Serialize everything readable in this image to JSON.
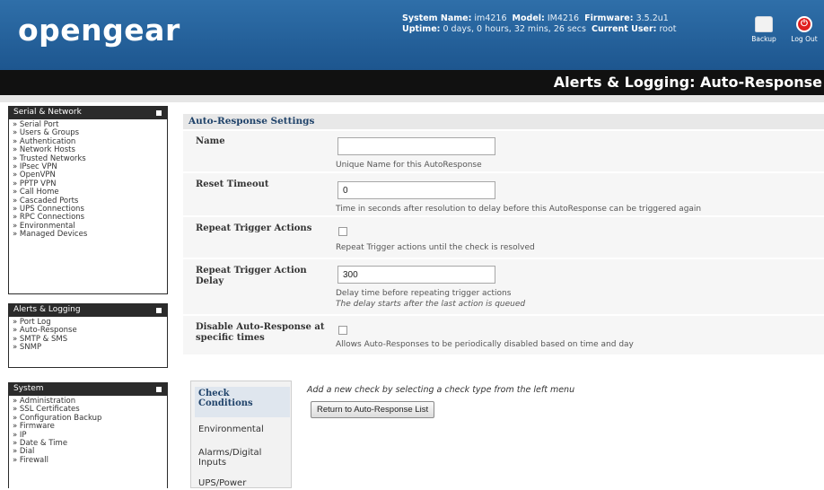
{
  "header": {
    "logo": "opengear",
    "system_name_label": "System Name:",
    "system_name": "im4216",
    "model_label": "Model:",
    "model": "IM4216",
    "firmware_label": "Firmware:",
    "firmware": "3.5.2u1",
    "uptime_label": "Uptime:",
    "uptime": "0 days, 0 hours, 32 mins, 26 secs",
    "current_user_label": "Current User:",
    "current_user": "root",
    "backup_label": "Backup",
    "logout_label": "Log Out",
    "brand_color": "#1d568f"
  },
  "page_title": "Alerts & Logging: Auto-Response",
  "sidebar": {
    "serial_network": {
      "title": "Serial & Network",
      "items": [
        "Serial Port",
        "Users & Groups",
        "Authentication",
        "Network Hosts",
        "Trusted Networks",
        "IPsec VPN",
        "OpenVPN",
        "PPTP VPN",
        "Call Home",
        "Cascaded Ports",
        "UPS Connections",
        "RPC Connections",
        "Environmental",
        "Managed Devices"
      ]
    },
    "alerts_logging": {
      "title": "Alerts & Logging",
      "items": [
        "Port Log",
        "Auto-Response",
        "SMTP & SMS",
        "SNMP"
      ]
    },
    "system": {
      "title": "System",
      "items": [
        "Administration",
        "SSL Certificates",
        "Configuration Backup",
        "Firmware",
        "IP",
        "Date & Time",
        "Dial",
        "Firewall"
      ]
    }
  },
  "settings": {
    "title": "Auto-Response Settings",
    "name": {
      "label": "Name",
      "value": "",
      "hint": "Unique Name for this AutoResponse"
    },
    "reset_timeout": {
      "label": "Reset Timeout",
      "value": "0",
      "hint": "Time in seconds after resolution to delay before this AutoResponse can be triggered again"
    },
    "repeat_trigger_actions": {
      "label": "Repeat Trigger Actions",
      "checked": false,
      "hint": "Repeat Trigger actions until the check is resolved"
    },
    "repeat_trigger_action_delay": {
      "label": "Repeat Trigger Action Delay",
      "value": "300",
      "hint": "Delay time before repeating trigger actions",
      "hint2": "The delay starts after the last action is queued"
    },
    "disable_auto_response": {
      "label": "Disable Auto-Response at specific times",
      "checked": false,
      "hint": "Allows Auto-Responses to be periodically disabled based on time and day"
    }
  },
  "check_conditions": {
    "title": "Check Conditions",
    "items": [
      "Environmental",
      "Alarms/Digital Inputs",
      "UPS/Power"
    ],
    "hint": "Add a new check by selecting a check type from the left menu",
    "return_button": "Return to Auto-Response List"
  }
}
